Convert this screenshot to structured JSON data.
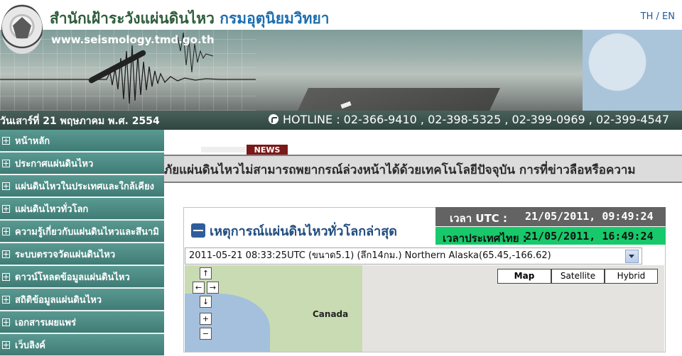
{
  "header": {
    "title_main": "สำนักเฝ้าระวังแผ่นดินไหว",
    "title_dept": "กรมอุตุนิยมวิทยา",
    "url": "www.seismology.tmd.go.th",
    "lang_th": "TH",
    "lang_sep": "/",
    "lang_en": "EN",
    "date_text": "วันเสาร์ที่ 21 พฤษภาคม พ.ศ. 2554",
    "hotline": "HOTLINE : 02-366-9410 , 02-398-5325 , 02-399-0969 , 02-399-4547"
  },
  "sidebar": {
    "items": [
      {
        "label": "หน้าหลัก"
      },
      {
        "label": "ประกาศแผ่นดินไหว"
      },
      {
        "label": "แผ่นดินไหวในประเทศและใกล้เคียง"
      },
      {
        "label": "แผ่นดินไหวทั่วโลก"
      },
      {
        "label": "ความรู้เกี่ยวกับแผ่นดินไหวและสึนามิ"
      },
      {
        "label": "ระบบตรวจวัดแผ่นดินไหว"
      },
      {
        "label": "ดาวน์โหลดข้อมูลแผ่นดินไหว"
      },
      {
        "label": "สถิติข้อมูลแผ่นดินไหว"
      },
      {
        "label": "เอกสารเผยแพร่"
      },
      {
        "label": "เว็บลิงค์"
      }
    ]
  },
  "news": {
    "badge": "NEWS",
    "ticker": "ภัยแผ่นดินไหวไม่สามารถพยากรณ์ล่วงหน้าได้ด้วยเทคโนโลยีปัจจุบัน การที่ข่าวลือหรือความ"
  },
  "quake_panel": {
    "title": "เหตุการณ์แผ่นดินไหวทั่วโลกล่าสุด",
    "utc_label": "เวลา UTC :",
    "utc_value": "21/05/2011, 09:49:24",
    "thai_label": "เวลาประเทศไทย :",
    "thai_value": "21/05/2011, 16:49:24",
    "selected_event": "2011-05-21 08:33:25UTC (ขนาด5.1) (ลึก14กม.) Northern Alaska(65.45,-166.62)"
  },
  "map": {
    "label_canada": "Canada",
    "types": [
      "Map",
      "Satellite",
      "Hybrid"
    ],
    "controls": {
      "up": "↑",
      "left": "←",
      "right": "→",
      "down": "↓",
      "zoom_in": "+",
      "zoom_out": "−"
    }
  },
  "colors": {
    "sidebar": "#4a8a83",
    "thai_time_bg": "#17c96a",
    "utc_bg": "#636363",
    "news_badge": "#7a1919"
  }
}
